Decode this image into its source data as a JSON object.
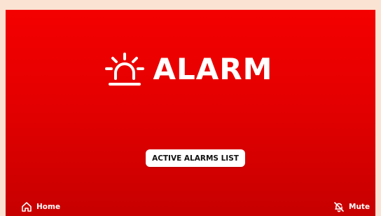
{
  "alarm": {
    "title": "ALARM"
  },
  "actions": {
    "active_alarms_list_label": "ACTIVE ALARMS LIST"
  },
  "footer": {
    "home_label": "Home",
    "mute_label": "Mute"
  },
  "icons": {
    "alarm": "alarm-light-icon",
    "home": "home-icon",
    "mute": "bell-off-icon"
  },
  "colors": {
    "background_top": "#f40000",
    "background_bottom": "#c70000",
    "text": "#ffffff",
    "button_background": "#ffffff",
    "button_text": "#111111"
  }
}
